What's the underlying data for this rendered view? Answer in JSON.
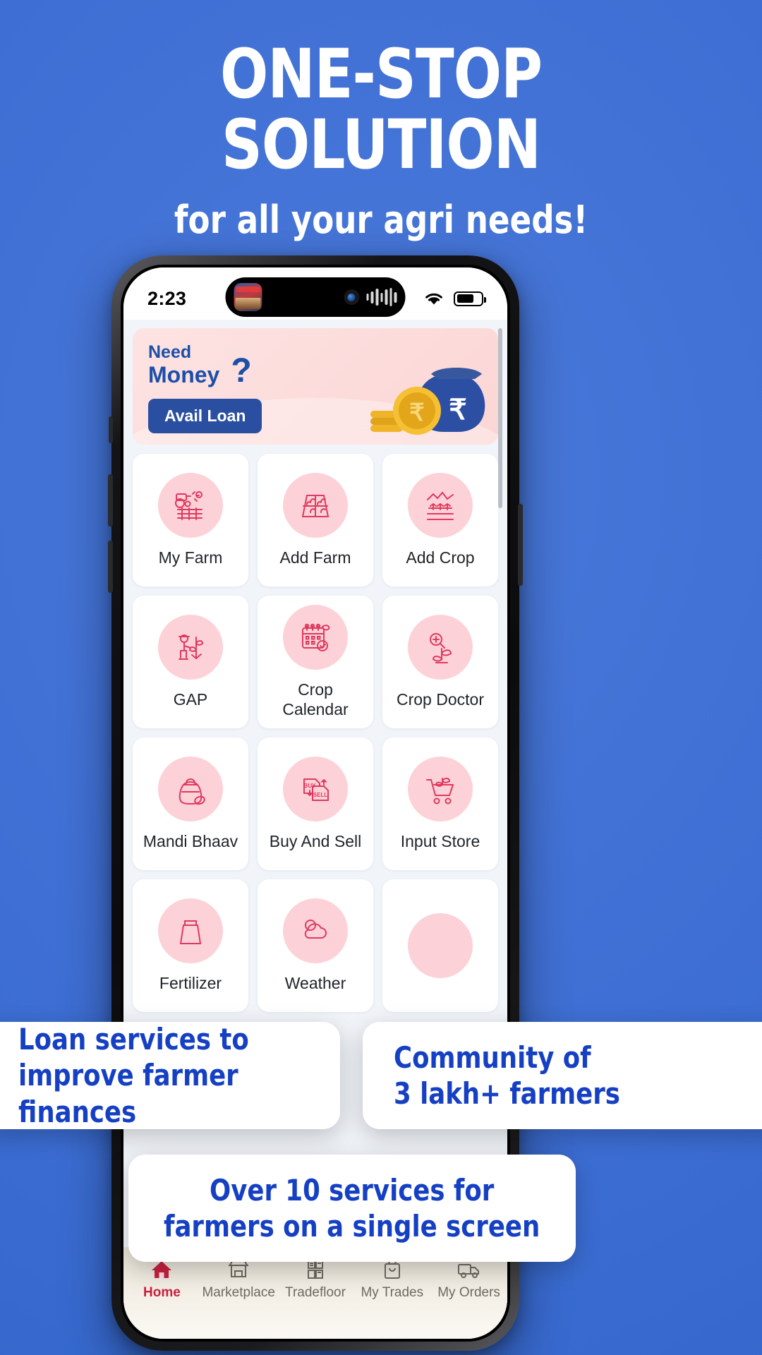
{
  "promo": {
    "headline_line1": "ONE-STOP",
    "headline_line2": "SOLUTION",
    "subhead": "for all your agri needs!",
    "bg_color": "#3f6fd4",
    "callouts": [
      {
        "line1": "Loan services to",
        "line2": "improve farmer finances"
      },
      {
        "line1": "Community of",
        "line2": "3 lakh+ farmers"
      },
      {
        "line1": "Over 10 services for",
        "line2": "farmers on a single screen"
      }
    ],
    "callout_text_color": "#1640c4"
  },
  "phone": {
    "status_bar": {
      "time": "2:23",
      "wifi_icon": "wifi-icon",
      "battery_icon": "battery-icon",
      "island_app_icon": "app-icon",
      "island_camera_icon": "camera-icon",
      "island_audio_icon": "audio-waveform-icon"
    },
    "loan_banner": {
      "line1": "Need",
      "line2": "Money",
      "question_mark": "?",
      "cta_label": "Avail Loan",
      "bg_color": "#fcdcdb",
      "text_color": "#1b4fa8",
      "cta_color": "#2a4fa0",
      "illustration": "money-bag-coins-rupee"
    },
    "services": [
      {
        "label": "My Farm",
        "icon": "tractor-field-icon"
      },
      {
        "label": "Add Farm",
        "icon": "farm-plot-plants-icon"
      },
      {
        "label": "Add Crop",
        "icon": "crop-rows-hills-icon"
      },
      {
        "label": "GAP",
        "icon": "farmer-plant-icon"
      },
      {
        "label": "Crop\nCalendar",
        "icon": "calendar-leaf-check-icon"
      },
      {
        "label": "Crop Doctor",
        "icon": "plant-magnifier-icon"
      },
      {
        "label": "Mandi Bhaav",
        "icon": "grain-sack-icon"
      },
      {
        "label": "Buy And Sell",
        "icon": "buy-sell-documents-icon"
      },
      {
        "label": "Input Store",
        "icon": "shopping-cart-leaf-icon"
      }
    ],
    "services_partial_row": [
      {
        "label": "Fertilizer",
        "icon": "fertilizer-icon"
      },
      {
        "label": "Weather",
        "icon": "weather-icon"
      }
    ],
    "tile_icon_bg": "#fcd2d8",
    "tile_icon_color": "#e0395f",
    "bottom_nav": {
      "active_color": "#c8213f",
      "items": [
        {
          "label": "Home",
          "icon": "home-icon",
          "active": true
        },
        {
          "label": "Marketplace",
          "icon": "storefront-icon",
          "active": false
        },
        {
          "label": "Tradefloor",
          "icon": "tradefloor-icon",
          "active": false
        },
        {
          "label": "My Trades",
          "icon": "bag-icon",
          "active": false
        },
        {
          "label": "My Orders",
          "icon": "truck-icon",
          "active": false
        }
      ]
    }
  }
}
